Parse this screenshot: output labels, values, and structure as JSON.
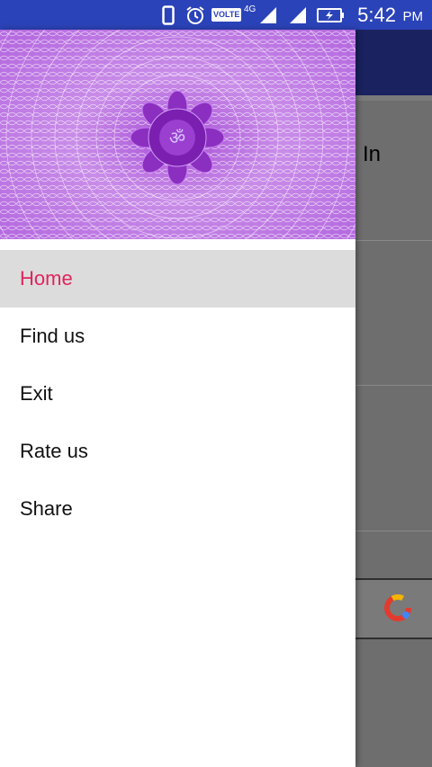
{
  "status_bar": {
    "time": "5:42",
    "ampm": "PM",
    "volte_label": "VOLTE",
    "network_label": "4G",
    "icons": [
      "phone-icon",
      "alarm-icon",
      "volte-icon",
      "signal-icon",
      "signal-icon",
      "battery-charging-icon"
    ]
  },
  "drawer": {
    "header_image": "crown-chakra-om-mandala",
    "menu_items": [
      {
        "label": "Home",
        "active": true
      },
      {
        "label": "Find us",
        "active": false
      },
      {
        "label": "Exit",
        "active": false
      },
      {
        "label": "Rate us",
        "active": false
      },
      {
        "label": "Share",
        "active": false
      }
    ]
  },
  "background": {
    "text": "In",
    "ad_icon": "ad-logo-icon"
  },
  "colors": {
    "status_bar": "#2b43b8",
    "toolbar": "#1a2260",
    "active_text": "#e0245e",
    "active_bg": "#dcdcdc",
    "header_purple": "#b45fe0"
  }
}
